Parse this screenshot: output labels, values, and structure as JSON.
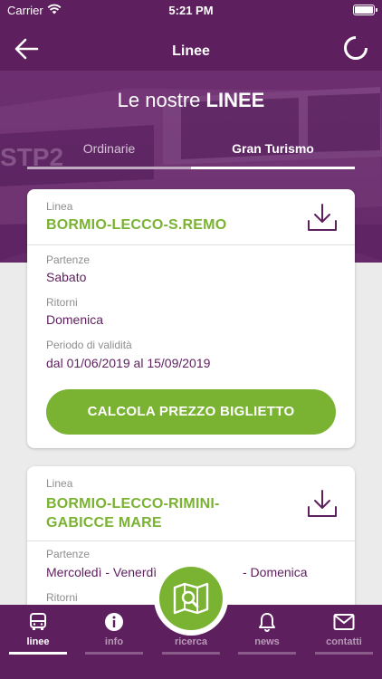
{
  "status": {
    "carrier": "Carrier",
    "time": "5:21 PM",
    "battery_level": 1.0
  },
  "nav": {
    "title": "Linee"
  },
  "hero": {
    "heading_prefix": "Le nostre",
    "heading_bold": "LINEE"
  },
  "tabs": [
    {
      "label": "Ordinarie",
      "selected": false
    },
    {
      "label": "Gran Turismo",
      "selected": true
    }
  ],
  "lines": [
    {
      "label_linea": "Linea",
      "name": "BORMIO-LECCO-S.REMO",
      "label_partenze": "Partenze",
      "partenze": "Sabato",
      "label_ritorni": "Ritorni",
      "ritorni": "Domenica",
      "label_validita": "Periodo di validità",
      "validita": "dal 01/06/2019 al 15/09/2019",
      "cta": "CALCOLA PREZZO BIGLIETTO"
    },
    {
      "label_linea": "Linea",
      "name_line1": "BORMIO-LECCO-RIMINI-",
      "name_line2": "GABICCE MARE",
      "label_partenze": "Partenze",
      "partenze_left": "Mercoledì - Venerdì",
      "partenze_right": "- Domenica",
      "label_ritorni": "Ritorni"
    }
  ],
  "tabbar": [
    {
      "label": "linee",
      "icon": "bus-icon",
      "active": true
    },
    {
      "label": "info",
      "icon": "info-icon",
      "active": false
    },
    {
      "label": "ricerca",
      "icon": "map-search-icon",
      "active": false
    },
    {
      "label": "news",
      "icon": "bell-icon",
      "active": false
    },
    {
      "label": "contatti",
      "icon": "mail-icon",
      "active": false
    }
  ],
  "colors": {
    "brand_purple": "#5e1f5e",
    "accent_green": "#7ab232",
    "value_purple": "#5e1f5e"
  }
}
